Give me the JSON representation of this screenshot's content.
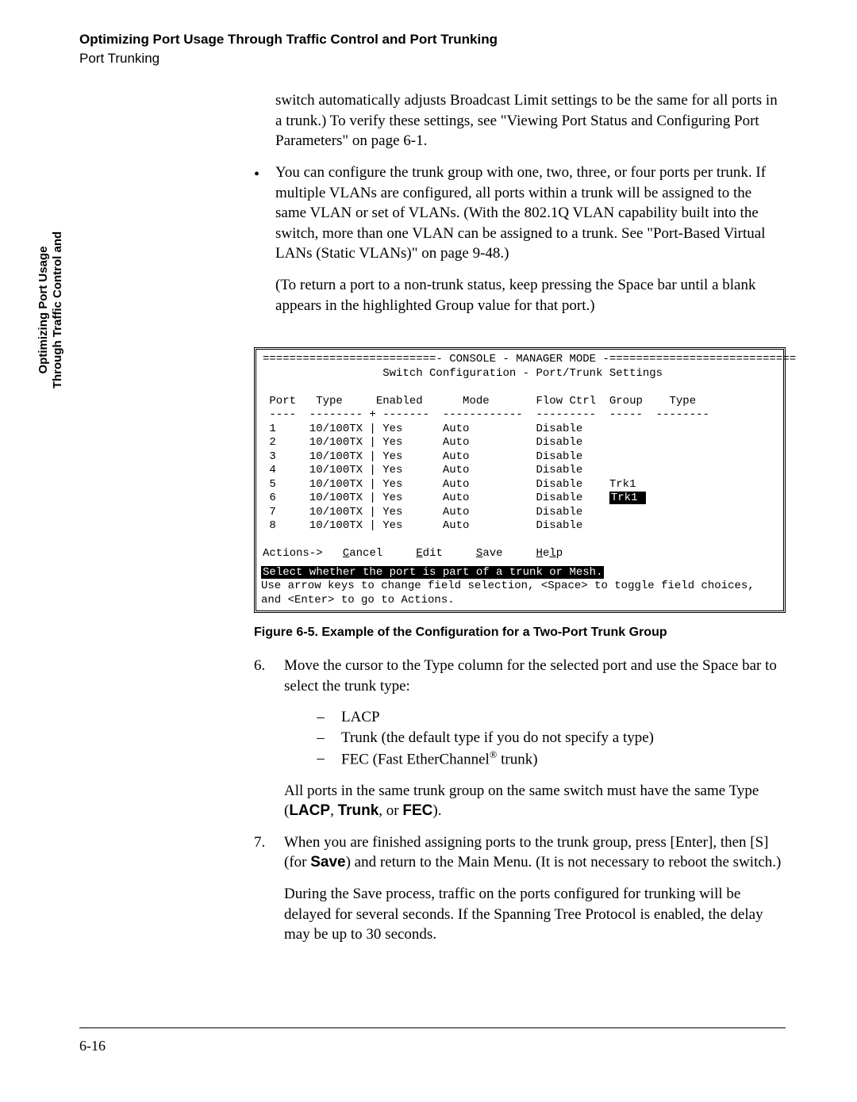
{
  "header": {
    "title": "Optimizing Port Usage Through Traffic Control and Port Trunking",
    "section": "Port Trunking"
  },
  "sidetab": {
    "l1": "Optimizing Port Usage",
    "l2": "Through Traffic Control and"
  },
  "body": {
    "para_continuation": "switch automatically adjusts Broadcast Limit settings to be the same for all ports in a trunk.) To verify these settings, see \"Viewing Port Status and Configuring Port Parameters\" on page 6-1.",
    "bullet_main": "You can configure the trunk group with one, two, three, or four ports per trunk. If multiple VLANs are configured, all ports within a trunk will be assigned to the same VLAN or set of VLANs. (With the 802.1Q VLAN capability built into the switch, more than one VLAN can be assigned to a trunk. See \"Port-Based Virtual LANs (Static VLANs)\" on page 9-48.)",
    "bullet_return": "(To return a port to a non-trunk status, keep pressing the Space bar until a blank appears in the highlighted Group value for that port.)"
  },
  "console": {
    "rule_title": "==========================- CONSOLE - MANAGER MODE -============================",
    "subtitle": "                  Switch Configuration - Port/Trunk Settings",
    "headers": " Port   Type     Enabled      Mode       Flow Ctrl  Group    Type",
    "divider": " ----  -------- + -------  ------------  ---------  -----  --------",
    "rows": [
      " 1     10/100TX | Yes      Auto          Disable",
      " 2     10/100TX | Yes      Auto          Disable",
      " 3     10/100TX | Yes      Auto          Disable",
      " 4     10/100TX | Yes      Auto          Disable",
      " 5     10/100TX | Yes      Auto          Disable    Trk1",
      " 7     10/100TX | Yes      Auto          Disable",
      " 8     10/100TX | Yes      Auto          Disable"
    ],
    "row6_pre": " 6     10/100TX | Yes      Auto          Disable    ",
    "row6_sel": "Trk1 ",
    "actions": {
      "prefix": "Actions->   ",
      "cancel_u": "C",
      "cancel_r": "ancel",
      "edit_u": "E",
      "edit_r": "dit",
      "save_u": "S",
      "save_r": "ave",
      "help_u": "H",
      "help_r": "e",
      "help_u2": "l",
      "help_r2": "p"
    },
    "help_sel": "Select whether the port is part of a trunk or Mesh.",
    "help_l1": "Use arrow keys to change field selection, <Space> to toggle field choices,",
    "help_l2": "and <Enter> to go to Actions."
  },
  "caption": "Figure 6-5.  Example of the Configuration for a Two-Port Trunk Group",
  "steps": {
    "s6_num": "6.",
    "s6_text": "Move the cursor to the Type column for the selected port and use the Space bar to select the trunk type:",
    "dash": "–",
    "d1": "LACP",
    "d2": "Trunk (the default type if you do not specify a type)",
    "d3_pre": "FEC (Fast EtherChannel",
    "d3_sup": "®",
    "d3_post": " trunk)",
    "s6_after_pre": "All ports in the same trunk group on the same switch must have the same Type (",
    "s6_after_b1": "LACP",
    "s6_after_mid1": ", ",
    "s6_after_b2": "Trunk",
    "s6_after_mid2": ", or ",
    "s6_after_b3": "FEC",
    "s6_after_post": ").",
    "s7_num": "7.",
    "s7_pre": "When you are finished assigning ports to the trunk group, press [Enter], then [S] (for ",
    "s7_bold": "Save",
    "s7_post": ") and return to the Main Menu. (It is not necessary to reboot the switch.)",
    "s7_after": "During the Save process, traffic on the ports configured for trunking will be delayed for several seconds. If the Spanning Tree Protocol is enabled, the delay may be up to 30 seconds."
  },
  "pagenum": "6-16"
}
